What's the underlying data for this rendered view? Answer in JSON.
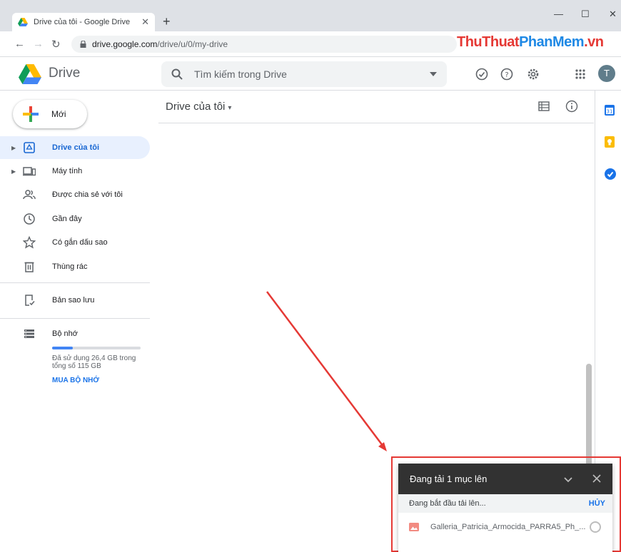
{
  "browser": {
    "tab_title": "Drive của tôi - Google Drive",
    "tab_close": "✕",
    "new_tab": "+",
    "minimize": "—",
    "maximize": "☐",
    "close": "✕",
    "url_host": "drive.google.com",
    "url_path": "/drive/u/0/my-drive",
    "watermark_a": "ThuThuat",
    "watermark_b": "PhanMem",
    "watermark_c": ".vn"
  },
  "header": {
    "app_name": "Drive",
    "search_placeholder": "Tìm kiếm trong Drive",
    "avatar_letter": "T"
  },
  "sidebar": {
    "new_label": "Mới",
    "items": [
      {
        "label": "Drive của tôi"
      },
      {
        "label": "Máy tính"
      },
      {
        "label": "Được chia sẻ với tôi"
      },
      {
        "label": "Gần đây"
      },
      {
        "label": "Có gắn dấu sao"
      },
      {
        "label": "Thùng rác"
      },
      {
        "label": "Bản sao lưu"
      },
      {
        "label": "Bộ nhớ"
      }
    ],
    "storage": {
      "used_fraction": 0.23,
      "text": "Đã sử dụng 26,4 GB trong tổng số 115 GB",
      "buy_label": "MUA BỘ NHỚ"
    }
  },
  "main": {
    "title": "Drive của tôi",
    "title_caret": "▾"
  },
  "upload": {
    "title": "Đang tải 1 mục lên",
    "status": "Đang bắt đầu tải lên...",
    "cancel": "HỦY",
    "file_name": "Galleria_Patricia_Armocida_PARRA5_Ph_..."
  },
  "colors": {
    "accent": "#1a73e8",
    "active_bg": "#e8f0fe",
    "annotation": "#e53935"
  }
}
